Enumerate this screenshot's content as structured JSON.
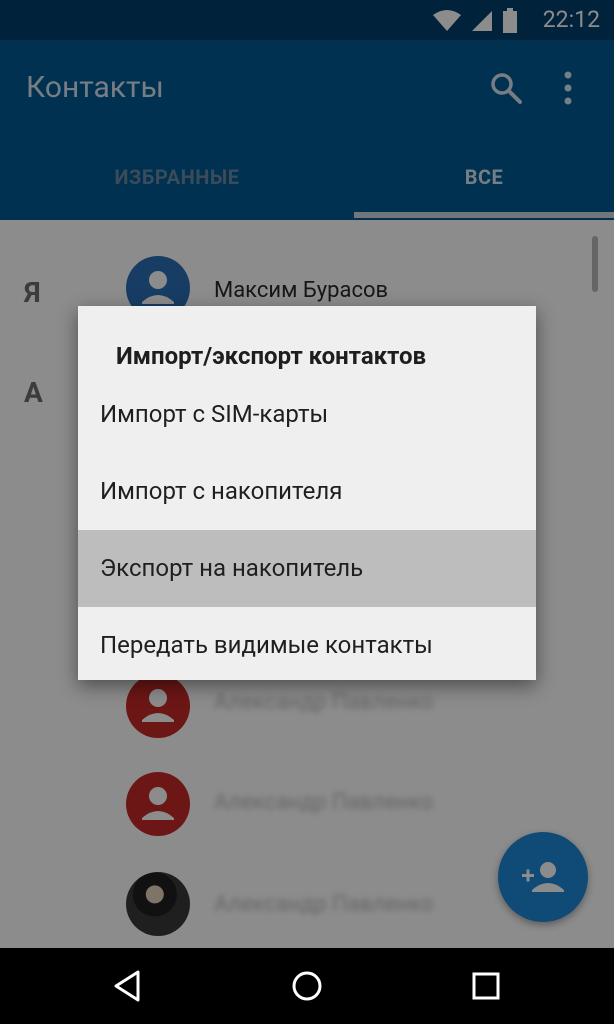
{
  "status_bar": {
    "time": "22:12",
    "icons": [
      "wifi-icon",
      "signal-icon",
      "battery-icon"
    ]
  },
  "app_bar": {
    "title": "Контакты",
    "actions": [
      "search-icon",
      "more-vert-icon"
    ]
  },
  "tabs": [
    {
      "label": "ИЗБРАННЫЕ",
      "selected": false
    },
    {
      "label": "ВСЕ",
      "selected": true
    }
  ],
  "contacts": {
    "section_letters": [
      "Я",
      "А"
    ],
    "items": [
      {
        "name": "Максим Бурасов",
        "avatar": "blue"
      },
      {
        "name": "Александр Павленко",
        "avatar": "red"
      },
      {
        "name": "Александр Павленко",
        "avatar": "red"
      },
      {
        "name": "Александр Павленко",
        "avatar": "photo"
      }
    ]
  },
  "dialog": {
    "title": "Импорт/экспорт контактов",
    "items": [
      {
        "label": "Импорт с SIM-карты",
        "pressed": false
      },
      {
        "label": "Импорт с накопителя",
        "pressed": false
      },
      {
        "label": "Экспорт на накопитель",
        "pressed": true
      },
      {
        "label": "Передать видимые контакты",
        "pressed": false
      }
    ]
  },
  "fab": {
    "icon": "add-person-icon"
  },
  "nav_bar": {
    "buttons": [
      "back-icon",
      "home-icon",
      "recents-icon"
    ]
  },
  "colors": {
    "primary": "#015a92",
    "status_bar": "#013f6b",
    "accent": "#1e88d8"
  }
}
